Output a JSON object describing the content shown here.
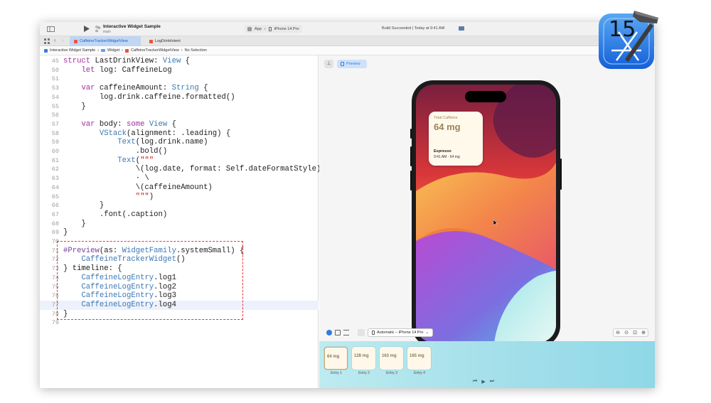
{
  "toolbar": {
    "project": "Interactive Widget Sample",
    "branch": "main",
    "scheme": "App",
    "device": "iPhone 14 Pro",
    "status": "Build Succeeded | Today at 9:41 AM"
  },
  "tabs": [
    {
      "label": "CaffeineTrackerWidgetView"
    },
    {
      "label": "LogDrinkIntent"
    }
  ],
  "breadcrumb": [
    "Interactive Widget Sample",
    "Widget",
    "CaffeineTrackerWidgetView",
    "No Selection"
  ],
  "code": [
    {
      "n": "45",
      "t": "struct LastDrinkView: View {"
    },
    {
      "n": "50",
      "t": "    let log: CaffeineLog"
    },
    {
      "n": "51",
      "t": ""
    },
    {
      "n": "53",
      "t": "    var caffeineAmount: String {"
    },
    {
      "n": "54",
      "t": "        log.drink.caffeine.formatted()"
    },
    {
      "n": "55",
      "t": "    }"
    },
    {
      "n": "56",
      "t": ""
    },
    {
      "n": "57",
      "t": "    var body: some View {"
    },
    {
      "n": "58",
      "t": "        VStack(alignment: .leading) {"
    },
    {
      "n": "59",
      "t": "            Text(log.drink.name)"
    },
    {
      "n": "60",
      "t": "                .bold()"
    },
    {
      "n": "61",
      "t": "            Text(\"\"\""
    },
    {
      "n": "62",
      "t": "                \\(log.date, format: Self.dateFormatStyle)\\"
    },
    {
      "n": "63",
      "t": "                · \\"
    },
    {
      "n": "64",
      "t": "                \\(caffeineAmount)"
    },
    {
      "n": "65",
      "t": "                \"\"\")"
    },
    {
      "n": "66",
      "t": "        }"
    },
    {
      "n": "67",
      "t": "        .font(.caption)"
    },
    {
      "n": "68",
      "t": "    }"
    },
    {
      "n": "69",
      "t": "}"
    },
    {
      "n": "70",
      "t": ""
    },
    {
      "n": "71",
      "t": "#Preview(as: WidgetFamily.systemSmall) {"
    },
    {
      "n": "72",
      "t": "    CaffeineTrackerWidget()"
    },
    {
      "n": "73",
      "t": "} timeline: {"
    },
    {
      "n": "74",
      "t": "    CaffeineLogEntry.log1"
    },
    {
      "n": "75",
      "t": "    CaffeineLogEntry.log2"
    },
    {
      "n": "76",
      "t": "    CaffeineLogEntry.log3"
    },
    {
      "n": "77",
      "t": "    CaffeineLogEntry.log4"
    },
    {
      "n": "78",
      "t": "}"
    },
    {
      "n": "79",
      "t": ""
    }
  ],
  "preview": {
    "label": "Preview",
    "device_selector": "Automatic – iPhone 14 Pro"
  },
  "widget": {
    "title": "Total Caffeine",
    "amount": "64 mg",
    "drink": "Espresso",
    "detail": "9:41 AM · 64 mg"
  },
  "entries": [
    {
      "amount": "64 mg",
      "label": "Entry 1"
    },
    {
      "amount": "128 mg",
      "label": "Entry 2"
    },
    {
      "amount": "163 mg",
      "label": "Entry 3"
    },
    {
      "amount": "165 mg",
      "label": "Entry 4"
    }
  ],
  "badge": {
    "number": "15"
  },
  "colors": {
    "accent": "#2f7de1",
    "highlight_box": "#e33333",
    "widget_bg": "#fff9ec"
  }
}
